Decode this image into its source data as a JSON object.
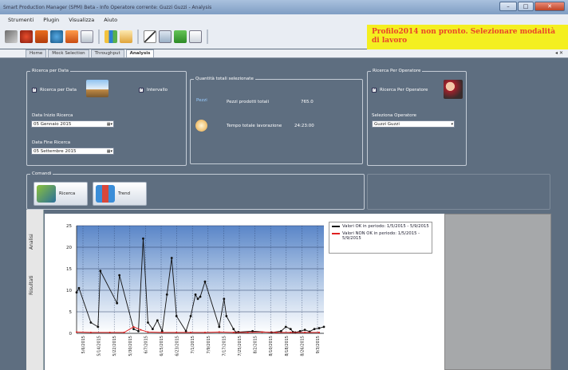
{
  "window": {
    "title": "Smart Production Manager (SPM) Beta - Info Operatore corrente: Guzzi Guzzi - Analysis"
  },
  "menu": [
    "Strumenti",
    "Plugin",
    "Visualizza",
    "Aiuto"
  ],
  "alert": {
    "text": "Profilo2014 non pronto. Selezionare modalità di lavoro"
  },
  "tabs": [
    {
      "label": "Home"
    },
    {
      "label": "Mock Selection"
    },
    {
      "label": "Throughput"
    },
    {
      "label": "Analysis"
    }
  ],
  "filter_date": {
    "title": "Ricerca per Data",
    "checkbox_date": "Ricerca per Data",
    "checkbox_interval": "Intervallo",
    "start_label": "Data Inizio Ricerca",
    "start_value": "05 Gennaio 2015",
    "end_label": "Data Fine Ricerca",
    "end_value": "05 Settembre 2015"
  },
  "quantities": {
    "title": "Quantità totali selezionate",
    "pieces_label": "Pezzi",
    "pieces_desc": "Pezzi prodotti totali",
    "pieces_value": "765.0",
    "time_desc": "Tempo totale lavorazione",
    "time_value": "24:23:00"
  },
  "operator": {
    "title": "Ricerca Per Operatore",
    "checkbox": "Ricerca Per Operatore",
    "select_label": "Seleziona Operatore",
    "select_value": "Guzzi Guzzi"
  },
  "commands": {
    "title": "Comandi",
    "search_button": "Ricerca",
    "trend_button": "Trend"
  },
  "side_tabs": [
    "Analisi",
    "Risultati"
  ],
  "chart_data": {
    "type": "line",
    "ylim": [
      0,
      25
    ],
    "yticks": [
      0,
      5,
      10,
      15,
      20,
      25
    ],
    "xticks": [
      "5/6/2015",
      "5/14/2015",
      "5/22/2015",
      "5/30/2015",
      "6/7/2015",
      "6/15/2015",
      "6/23/2015",
      "7/1/2015",
      "7/9/2015",
      "7/17/2015",
      "7/25/2015",
      "8/2/2015",
      "8/10/2015",
      "8/18/2015",
      "8/26/2015",
      "9/3/2015"
    ],
    "series": [
      {
        "name": "Valori OK in periodo: 1/5/2015 - 5/9/2015",
        "color": "#111111",
        "points": [
          [
            0,
            9.5
          ],
          [
            0.5,
            10.5
          ],
          [
            3,
            2.5
          ],
          [
            4.5,
            1.5
          ],
          [
            5,
            14.5
          ],
          [
            8.5,
            7
          ],
          [
            9,
            13.5
          ],
          [
            12,
            1
          ],
          [
            13,
            0.5
          ],
          [
            14,
            22
          ],
          [
            15,
            2.5
          ],
          [
            16,
            1
          ],
          [
            17,
            3
          ],
          [
            18,
            0.5
          ],
          [
            19,
            9
          ],
          [
            20,
            17.5
          ],
          [
            21,
            4
          ],
          [
            23,
            0.5
          ],
          [
            24,
            4
          ],
          [
            25,
            9
          ],
          [
            25.5,
            8
          ],
          [
            26,
            8.5
          ],
          [
            27,
            12
          ],
          [
            30,
            1.5
          ],
          [
            31,
            8
          ],
          [
            31.5,
            4
          ],
          [
            33,
            1
          ],
          [
            33.5,
            0.2
          ],
          [
            34,
            0.3
          ],
          [
            37,
            0.5
          ],
          [
            41,
            0.2
          ],
          [
            43,
            0.5
          ],
          [
            44,
            1.5
          ],
          [
            45,
            1
          ],
          [
            45.5,
            0.3
          ],
          [
            46,
            0.2
          ],
          [
            47,
            0.5
          ],
          [
            48,
            0.8
          ],
          [
            49,
            0.4
          ],
          [
            50,
            1
          ],
          [
            51,
            1.2
          ],
          [
            52,
            1.5
          ]
        ]
      },
      {
        "name": "Valori NON OK in periodo: 1/5/2015 - 5/9/2015",
        "color": "#e02020",
        "points": [
          [
            0,
            0.3
          ],
          [
            3,
            0.2
          ],
          [
            7,
            0.2
          ],
          [
            10,
            0.2
          ],
          [
            12,
            1.5
          ],
          [
            13.5,
            0.8
          ],
          [
            15,
            0.3
          ],
          [
            18,
            0.2
          ],
          [
            21,
            0.2
          ],
          [
            24,
            0.2
          ],
          [
            27,
            0.2
          ],
          [
            30,
            0.3
          ],
          [
            33,
            0.2
          ],
          [
            36,
            0.2
          ],
          [
            39,
            0.3
          ],
          [
            42,
            0.2
          ],
          [
            45,
            0.2
          ],
          [
            48,
            0.2
          ],
          [
            51,
            0.2
          ]
        ]
      }
    ],
    "xrange": [
      0,
      52
    ]
  }
}
